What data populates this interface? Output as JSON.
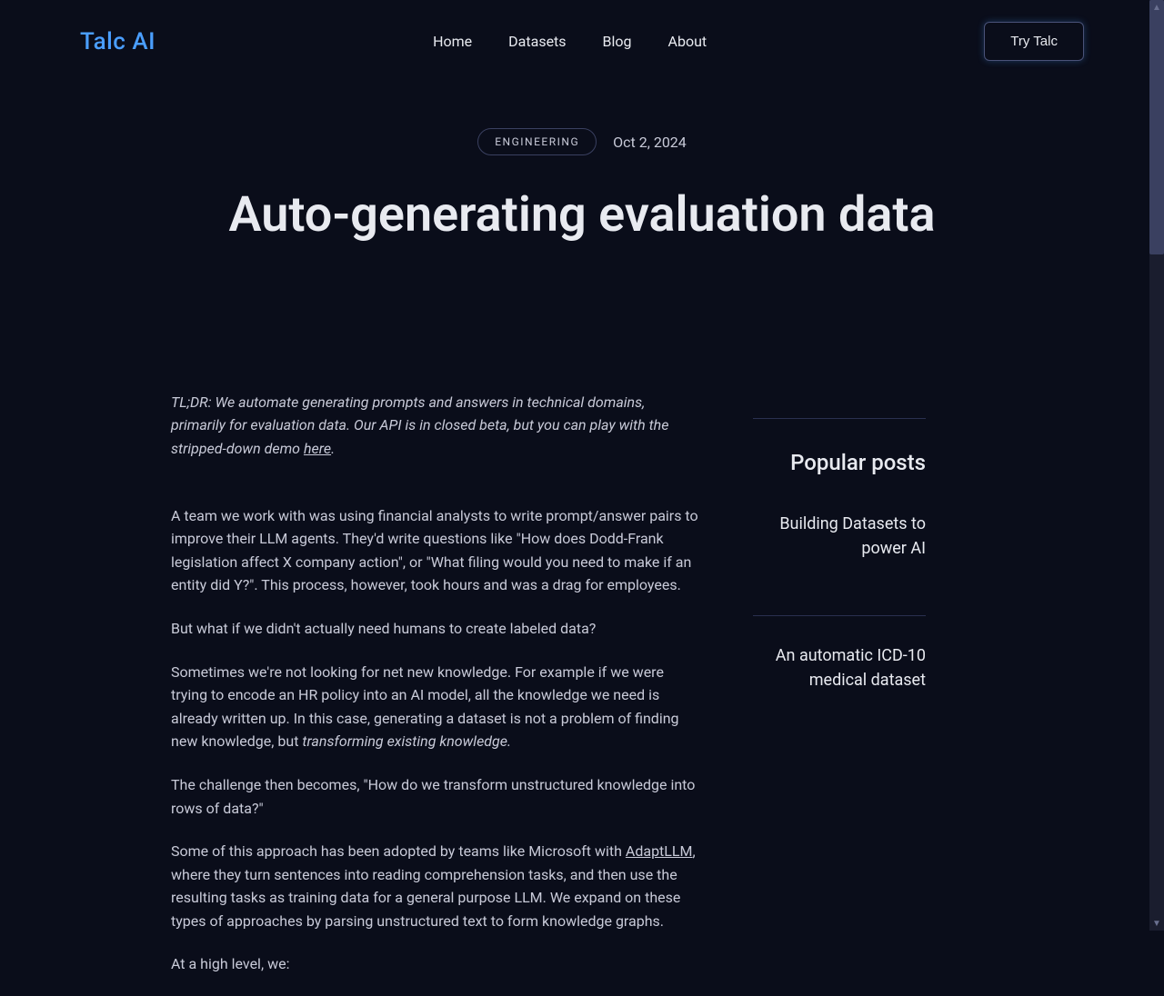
{
  "header": {
    "logo": "Talc AI",
    "nav": {
      "home": "Home",
      "datasets": "Datasets",
      "blog": "Blog",
      "about": "About"
    },
    "cta": "Try Talc"
  },
  "hero": {
    "category": "ENGINEERING",
    "date": "Oct 2, 2024",
    "title": "Auto-generating evaluation data"
  },
  "article": {
    "tldr_prefix": "TL;DR: We automate generating prompts and answers in technical domains, primarily for evaluation data. Our API is in closed beta, but you can play with the stripped-down demo ",
    "tldr_link": "here",
    "tldr_suffix": ".",
    "p1": "A team we work with was using financial analysts to write prompt/answer pairs to improve their LLM agents. They'd write questions like \"How does Dodd-Frank legislation affect X company action\", or \"What filing would you need to make if an entity did Y?\". This process, however, took hours and was a drag for employees.",
    "p2": "But what if we didn't actually need humans to create labeled data?",
    "p3_prefix": "Sometimes we're not looking for net new knowledge. For example if we were trying to encode an HR policy into an AI model, all the knowledge we need is already written up. In this case, generating a dataset is not a problem of finding new knowledge, but ",
    "p3_italic": "transforming existing knowledge.",
    "p4": "The challenge then becomes, \"How do we transform unstructured knowledge into rows of data?\"",
    "p5_prefix": "Some of this approach has been adopted by teams like Microsoft with ",
    "p5_link": "AdaptLLM",
    "p5_suffix": ", where they turn sentences into reading comprehension tasks, and then use the resulting tasks as training data for a general purpose LLM. We expand on these types of approaches by parsing unstructured text to form knowledge graphs.",
    "p6": "At a high level, we:"
  },
  "sidebar": {
    "title": "Popular posts",
    "posts": [
      "Building Datasets to power AI",
      "An automatic ICD-10 medical dataset"
    ]
  }
}
